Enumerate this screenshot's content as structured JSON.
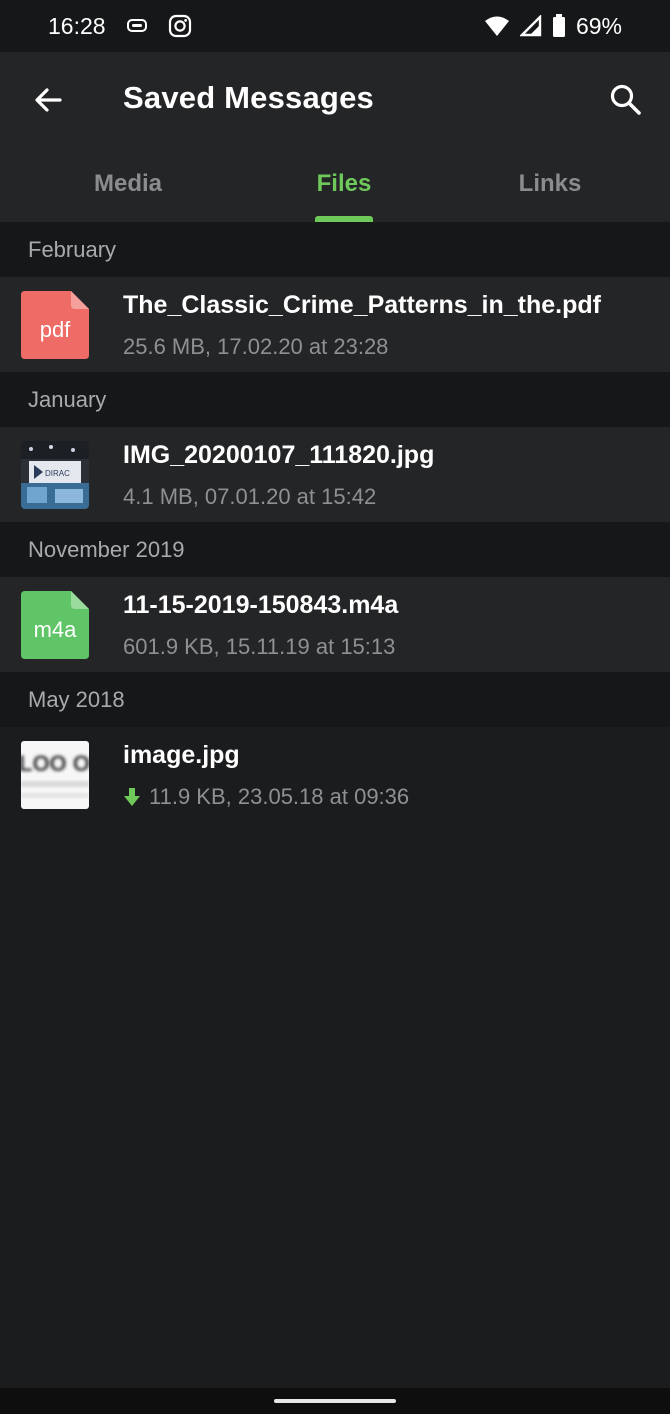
{
  "status_bar": {
    "time": "16:28",
    "icons_left": [
      "cast-icon",
      "instagram-icon"
    ],
    "icons_right": [
      "wifi-icon",
      "signal-icon",
      "battery-icon"
    ],
    "battery": "69%"
  },
  "app_bar": {
    "title": "Saved Messages",
    "back_icon": "arrow-left-icon",
    "search_icon": "search-icon"
  },
  "tabs": [
    {
      "label": "Media",
      "active": false
    },
    {
      "label": "Files",
      "active": true
    },
    {
      "label": "Links",
      "active": false
    }
  ],
  "colors": {
    "accent": "#6fc85a",
    "background": "#1b1c1e",
    "surface": "#242527",
    "section_bg": "#161718",
    "pdf_icon": "#ee6b66",
    "m4a_icon": "#5fc566"
  },
  "sections": [
    {
      "header": "February",
      "files": [
        {
          "name": "The_Classic_Crime_Patterns_in_the.pdf",
          "meta": "25.6 MB, 17.02.20 at 23:28",
          "icon": "pdf",
          "ext": "pdf"
        }
      ]
    },
    {
      "header": "January",
      "files": [
        {
          "name": "IMG_20200107_111820.jpg",
          "meta": "4.1 MB, 07.01.20 at 15:42",
          "icon": "photo-thumbnail",
          "thumb_text": "DIRAC"
        }
      ]
    },
    {
      "header": "November 2019",
      "files": [
        {
          "name": "11-15-2019-150843.m4a",
          "meta": "601.9 KB, 15.11.19 at 15:13",
          "icon": "m4a",
          "ext": "m4a"
        }
      ]
    },
    {
      "header": "May 2018",
      "files": [
        {
          "name": "image.jpg",
          "meta": "11.9 KB, 23.05.18 at 09:36",
          "icon": "image-thumbnail",
          "download_icon": "download-arrow-icon",
          "thumb_text": "LOO OI"
        }
      ]
    }
  ]
}
